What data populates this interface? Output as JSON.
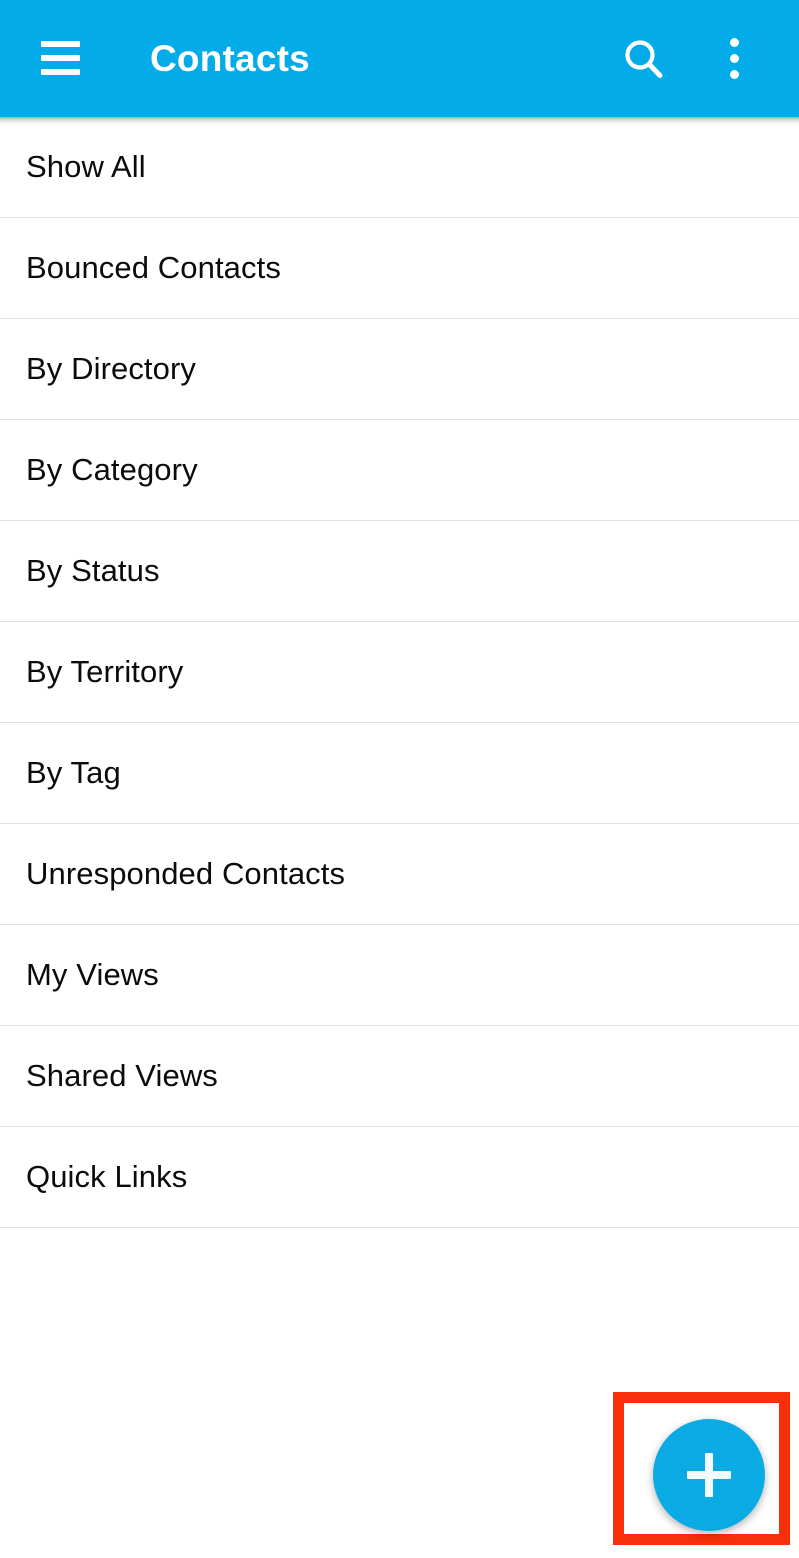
{
  "appbar": {
    "title": "Contacts",
    "menu_icon": "hamburger-menu-icon",
    "search_icon": "search-icon",
    "overflow_icon": "overflow-menu-icon",
    "background_color": "#03ABE9",
    "title_color": "#FFFFFF"
  },
  "list": {
    "items": [
      {
        "label": "Show All"
      },
      {
        "label": "Bounced Contacts"
      },
      {
        "label": "By Directory"
      },
      {
        "label": "By Category"
      },
      {
        "label": "By Status"
      },
      {
        "label": "By Territory"
      },
      {
        "label": "By Tag"
      },
      {
        "label": "Unresponded Contacts"
      },
      {
        "label": "My Views"
      },
      {
        "label": "Shared Views"
      },
      {
        "label": "Quick Links"
      }
    ]
  },
  "fab": {
    "icon": "plus-icon",
    "color": "#0AAAE4",
    "icon_color": "#F2FBFD"
  },
  "annotation": {
    "highlight_color": "#F8300A",
    "target": "add-contact-fab"
  }
}
